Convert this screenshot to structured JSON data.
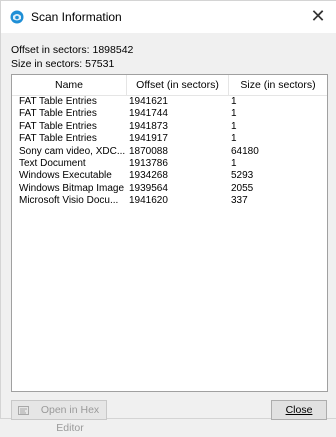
{
  "window": {
    "title": "Scan Information"
  },
  "info": {
    "offset_text": "Offset in sectors: 1898542",
    "size_text": "Size in sectors: 57531"
  },
  "table": {
    "columns": [
      "Name",
      "Offset (in sectors)",
      "Size (in sectors)"
    ],
    "rows": [
      {
        "name": "FAT Table Entries",
        "offset": "1941621",
        "size": "1"
      },
      {
        "name": "FAT Table Entries",
        "offset": "1941744",
        "size": "1"
      },
      {
        "name": "FAT Table Entries",
        "offset": "1941873",
        "size": "1"
      },
      {
        "name": "FAT Table Entries",
        "offset": "1941917",
        "size": "1"
      },
      {
        "name": "Sony cam video, XDC...",
        "offset": "1870088",
        "size": "64180"
      },
      {
        "name": "Text Document",
        "offset": "1913786",
        "size": "1"
      },
      {
        "name": "Windows Executable",
        "offset": "1934268",
        "size": "5293"
      },
      {
        "name": "Windows Bitmap Image",
        "offset": "1939564",
        "size": "2055"
      },
      {
        "name": "Microsoft Visio Docu...",
        "offset": "1941620",
        "size": "337"
      }
    ]
  },
  "buttons": {
    "open_hex": "Open in Hex Editor",
    "close": "Close"
  },
  "icons": {
    "app": "scan-app-icon",
    "close": "close-icon",
    "hex": "hex-editor-icon"
  }
}
